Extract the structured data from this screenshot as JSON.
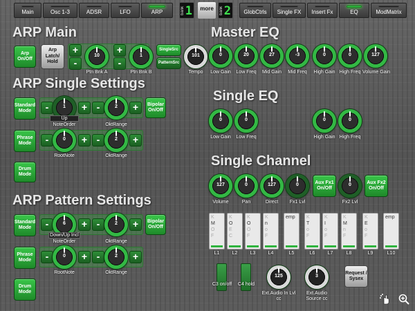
{
  "topbar": {
    "tabs": [
      {
        "label": "Main",
        "active": false
      },
      {
        "label": "Osc 1-3",
        "active": false
      },
      {
        "label": "ADSR",
        "active": false
      },
      {
        "label": "LFO",
        "active": false
      },
      {
        "label": "ARP",
        "active": true
      },
      {
        "label": "GlobCtrls",
        "active": false
      },
      {
        "label": "Single FX",
        "active": false
      },
      {
        "label": "Insert Fx",
        "active": false
      },
      {
        "label": "EQ",
        "active": true
      },
      {
        "label": "ModMatrix",
        "active": false
      }
    ],
    "bank_left": {
      "label": "bank",
      "number": "1"
    },
    "more_label": "more",
    "bank_right": {
      "label": "bank",
      "number": "2"
    }
  },
  "arp_main": {
    "heading": "ARP Main",
    "arp_onoff": "Arp On/Off",
    "arp_latch": "Arp Latch/ Hold",
    "ptn_bnk_a": {
      "label": "Ptn Bnk A",
      "value": "10"
    },
    "ptn_bnk_b": {
      "label": "Ptn Bnk B",
      "value": "1"
    },
    "single_src": "SingleSrc",
    "pattern_src": "PatternSrc",
    "tempo": {
      "label": "Tempo",
      "value": "101"
    }
  },
  "arp_single": {
    "heading": "ARP Single Settings",
    "standard_mode": "Standard Mode",
    "note_order": {
      "label": "NoteOrder",
      "value": "1",
      "display": "Up"
    },
    "okt_range_1": {
      "label": "OktRange",
      "value": "2"
    },
    "bipolar": "Bipolar On/Off",
    "phase_mode": "Phrase Mode",
    "root_note": {
      "label": "RootNote",
      "value": "0"
    },
    "okt_range_2": {
      "label": "OktRange",
      "value": "2"
    },
    "drum_mode": "Drum Mode"
  },
  "arp_pattern": {
    "heading": "ARP Pattern Settings",
    "standard_mode": "Standard Mode",
    "note_order": {
      "label": "NoteOrder",
      "value": "6",
      "display": "Down/Up Incl"
    },
    "okt_range_1": {
      "label": "OktRange",
      "value": "2"
    },
    "bipolar": "Bipolar On/Off",
    "phase_mode": "Phrase Mode",
    "root_note": {
      "label": "RootNote",
      "value": "0"
    },
    "okt_range_2": {
      "label": "OktRange",
      "value": "2"
    },
    "drum_mode": "Drum Mode"
  },
  "master_eq": {
    "heading": "Master EQ",
    "knobs": [
      {
        "label": "Low Gain",
        "value": "0"
      },
      {
        "label": "Low Freq",
        "value": "20"
      },
      {
        "label": "Mid Gain",
        "value": "27"
      },
      {
        "label": "Mid Freq",
        "value": "-3"
      },
      {
        "label": "High Gain",
        "value": "0"
      },
      {
        "label": "High Freq",
        "value": "0"
      },
      {
        "label": "Volume Gain",
        "value": "127"
      }
    ]
  },
  "single_eq": {
    "heading": "Single EQ",
    "knobs": [
      {
        "label": "Low Gain",
        "value": "0"
      },
      {
        "label": "Low Freq",
        "value": "0"
      },
      {
        "label": "High Gain",
        "value": "0"
      },
      {
        "label": "High Freq",
        "value": "0"
      }
    ]
  },
  "single_channel": {
    "heading": "Single Channel",
    "volume": {
      "label": "Volume",
      "value": "127"
    },
    "pan": {
      "label": "Pan",
      "value": "0"
    },
    "direct": {
      "label": "Direct",
      "value": "127"
    },
    "fx1": {
      "label": "Fx1 Lvl",
      "value": "0"
    },
    "aux_fx1": "Aux Fx1 On/Off",
    "fx2": {
      "label": "Fx2 Lvl",
      "value": "0"
    },
    "aux_fx2": "Aux Fx2 On/Off"
  },
  "slots": [
    {
      "label": "L1",
      "lines": [
        "K",
        "M",
        "O",
        "F"
      ]
    },
    {
      "label": "L2",
      "lines": [
        "K",
        "O",
        "E",
        "C"
      ]
    },
    {
      "label": "L3",
      "lines": [
        "K",
        "O",
        "O",
        "F"
      ]
    },
    {
      "label": "L4",
      "lines": [
        "K",
        "n",
        "o",
        "F"
      ]
    },
    {
      "label": "L5",
      "lines": [
        "",
        "emp",
        "",
        ""
      ]
    },
    {
      "label": "L6",
      "lines": [
        "K",
        "T",
        "o",
        "F"
      ]
    },
    {
      "label": "L7",
      "lines": [
        "K",
        "I",
        "o",
        "F"
      ]
    },
    {
      "label": "L8",
      "lines": [
        "K",
        "M",
        "n",
        "F"
      ]
    },
    {
      "label": "L9",
      "lines": [
        "K",
        "E",
        "o",
        "F"
      ]
    },
    {
      "label": "L10",
      "lines": [
        "",
        "emp",
        "",
        ""
      ]
    }
  ],
  "bottom": {
    "c3_onoff": "C3 on/off",
    "c4_hold": "C4 hold",
    "ext_audio_in": {
      "label": "Ext.Audio In Lvl cc",
      "value": "125"
    },
    "ext_audio_src": {
      "label": "Ext.Audio Source cc",
      "value": "3"
    },
    "request_sysex": "Request / Sysex"
  },
  "icons": {
    "move": "move-hand-icon",
    "zoom": "zoom-icon"
  },
  "colors": {
    "accent": "#39c549",
    "knob_ring": "#33b844"
  }
}
